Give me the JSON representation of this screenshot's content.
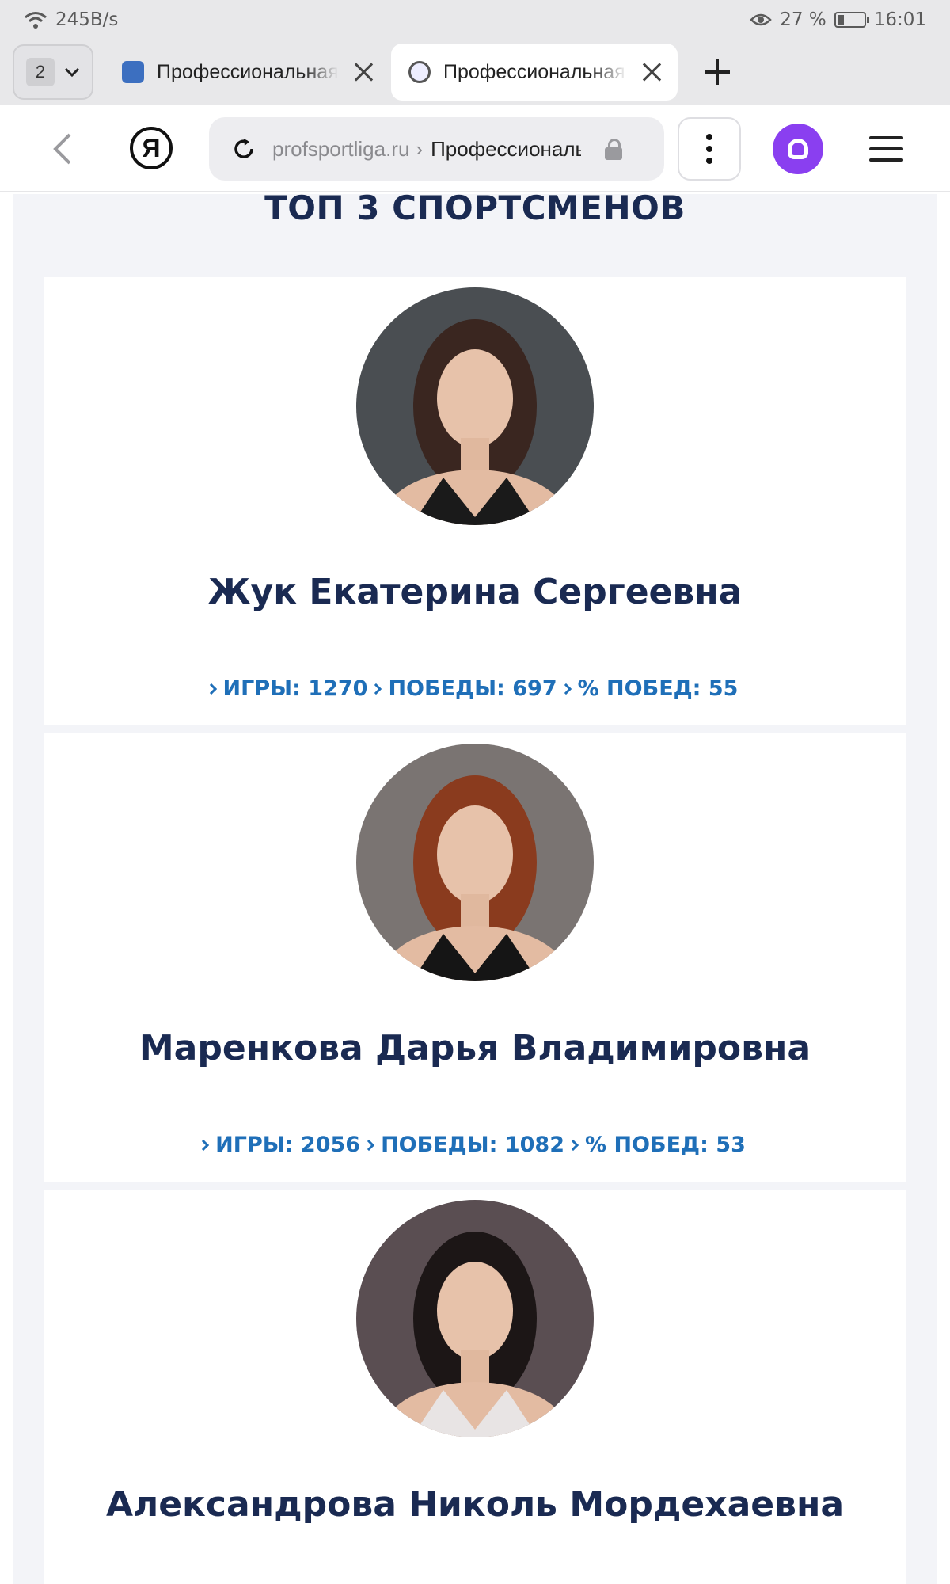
{
  "status_bar": {
    "net_speed": "245B/s",
    "battery_percent": "27 %",
    "battery_level": 0.27,
    "time": "16:01"
  },
  "tabs": {
    "count": "2",
    "items": [
      {
        "title": "Профессиональная",
        "active": false
      },
      {
        "title": "Профессиональная",
        "active": true
      }
    ]
  },
  "address_bar": {
    "logo": "Я",
    "domain": "profsportliga.ru",
    "separator": "›",
    "page_title": "Профессиональная"
  },
  "page": {
    "section_title": "ТОП 3 СПОРТСМЕНОВ",
    "athletes": [
      {
        "name": "Жук Екатерина Сергеевна",
        "games_label": "ИГРЫ: 1270",
        "wins_label": "ПОБЕДЫ: 697",
        "pct_label": "% ПОБЕД: 55",
        "hair": "#3a2620",
        "bg": "#4a4e52",
        "dress": "#1a1a1a"
      },
      {
        "name": "Маренкова Дарья Владимировна",
        "games_label": "ИГРЫ: 2056",
        "wins_label": "ПОБЕДЫ: 1082",
        "pct_label": "% ПОБЕД: 53",
        "hair": "#8a3b1e",
        "bg": "#7a7472",
        "dress": "#151515"
      },
      {
        "name": "Александрова Николь Мордехаевна",
        "games_label": "",
        "wins_label": "",
        "pct_label": "",
        "hair": "#1c1616",
        "bg": "#5a4e52",
        "dress": "#e8e4e4"
      }
    ]
  }
}
